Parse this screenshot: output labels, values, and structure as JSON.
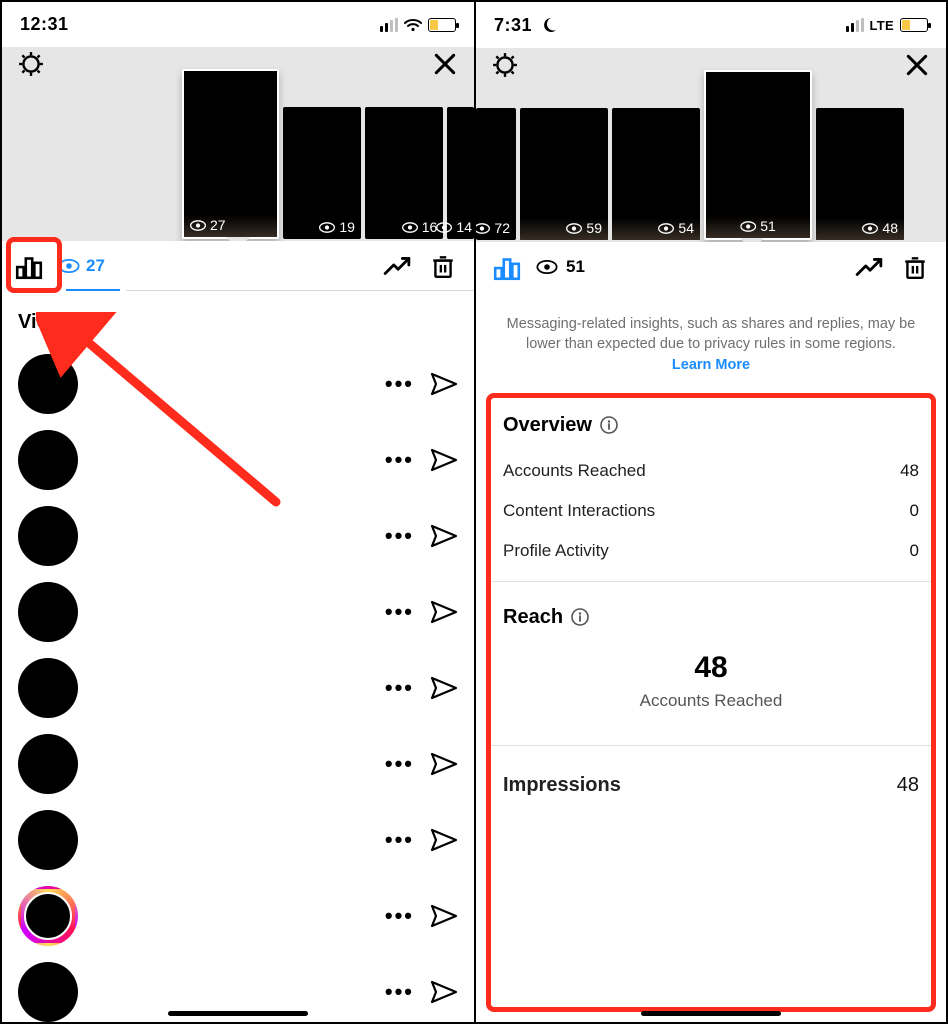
{
  "left": {
    "status": {
      "time": "12:31"
    },
    "strip": [
      {
        "views": "27",
        "selected": true
      },
      {
        "views": "19",
        "selected": false
      },
      {
        "views": "16",
        "selected": false
      },
      {
        "views": "14",
        "selected": false,
        "partial": true
      }
    ],
    "toolbar": {
      "count": "27"
    },
    "viewers_title": "Viewers"
  },
  "right": {
    "status": {
      "time": "7:31",
      "network": "LTE"
    },
    "strip": [
      {
        "views": "72",
        "selected": false,
        "partial": true
      },
      {
        "views": "59",
        "selected": false
      },
      {
        "views": "54",
        "selected": false
      },
      {
        "views": "51",
        "selected": true
      },
      {
        "views": "48",
        "selected": false
      }
    ],
    "toolbar": {
      "count": "51"
    },
    "notice": {
      "text": "Messaging-related insights, such as shares and replies, may be lower than expected due to privacy rules in some regions. ",
      "link": "Learn More"
    },
    "overview": {
      "title": "Overview",
      "rows": [
        {
          "label": "Accounts Reached",
          "value": "48"
        },
        {
          "label": "Content Interactions",
          "value": "0"
        },
        {
          "label": "Profile Activity",
          "value": "0"
        }
      ]
    },
    "reach": {
      "title": "Reach",
      "number": "48",
      "sub": "Accounts Reached"
    },
    "impressions": {
      "title": "Impressions",
      "value": "48"
    }
  }
}
